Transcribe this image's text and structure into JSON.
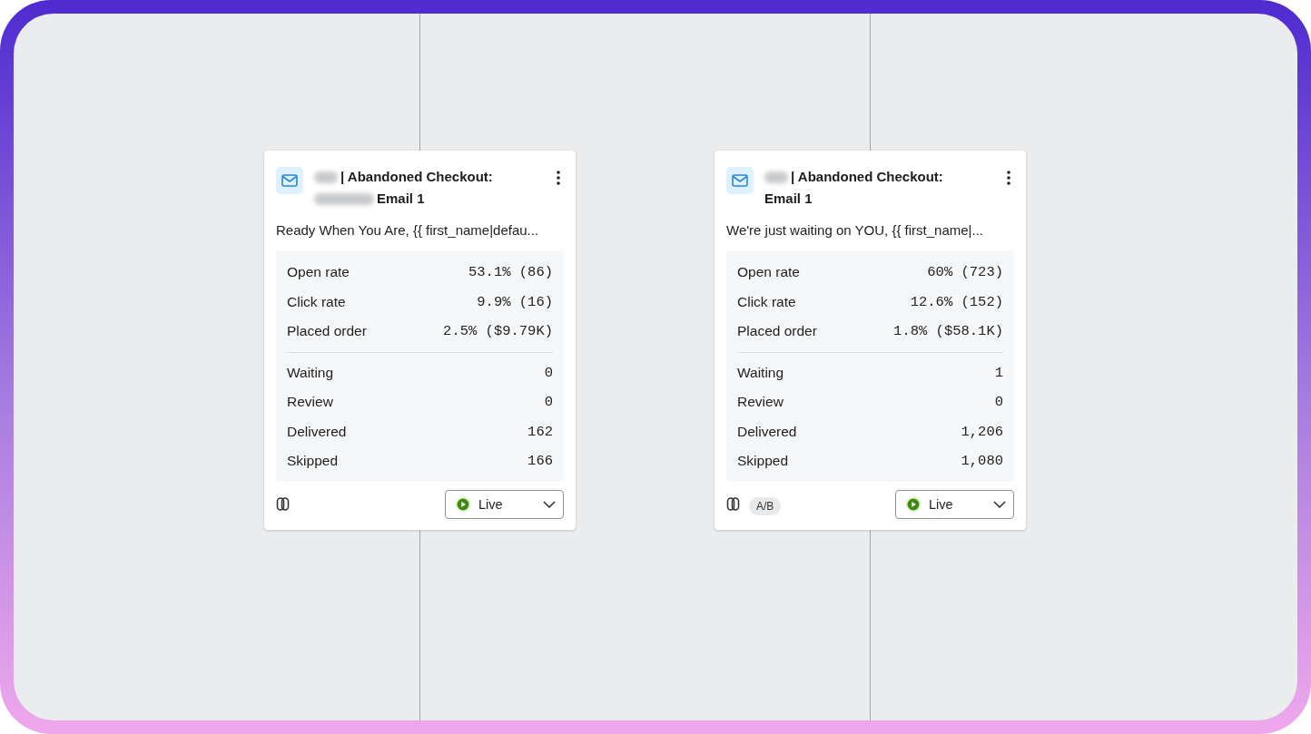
{
  "cards": [
    {
      "title_lines": [
        [
          {
            "kind": "redacted",
            "wide": false
          },
          {
            "kind": "text",
            "text": "| Abandoned Checkout:"
          }
        ],
        [
          {
            "kind": "redacted",
            "wide": true
          },
          {
            "kind": "text",
            "text": "Email 1"
          }
        ]
      ],
      "subject": "Ready When You Are, {{ first_name|defau...",
      "metrics": [
        {
          "label": "Open rate",
          "value": "53.1% (86)"
        },
        {
          "label": "Click rate",
          "value": "9.9% (16)"
        },
        {
          "label": "Placed order",
          "value": "2.5% ($9.79K)"
        }
      ],
      "counts": [
        {
          "label": "Waiting",
          "value": "0"
        },
        {
          "label": "Review",
          "value": "0"
        },
        {
          "label": "Delivered",
          "value": "162"
        },
        {
          "label": "Skipped",
          "value": "166"
        }
      ],
      "status": {
        "kind": "live",
        "label": "Live"
      }
    },
    {
      "title_lines": [
        [
          {
            "kind": "redacted",
            "wide": false
          },
          {
            "kind": "text",
            "text": "| Abandoned Checkout:"
          }
        ],
        [
          {
            "kind": "text",
            "text": "Email 1"
          }
        ]
      ],
      "subject": "We're just waiting on YOU, {{ first_name|...",
      "metrics": [
        {
          "label": "Open rate",
          "value": "60% (723)"
        },
        {
          "label": "Click rate",
          "value": "12.6% (152)"
        },
        {
          "label": "Placed order",
          "value": "1.8% ($58.1K)"
        }
      ],
      "counts": [
        {
          "label": "Waiting",
          "value": "1"
        },
        {
          "label": "Review",
          "value": "0"
        },
        {
          "label": "Delivered",
          "value": "1,206"
        },
        {
          "label": "Skipped",
          "value": "1,080"
        }
      ],
      "badge": "A/B",
      "status": {
        "kind": "live",
        "label": "Live"
      }
    }
  ]
}
